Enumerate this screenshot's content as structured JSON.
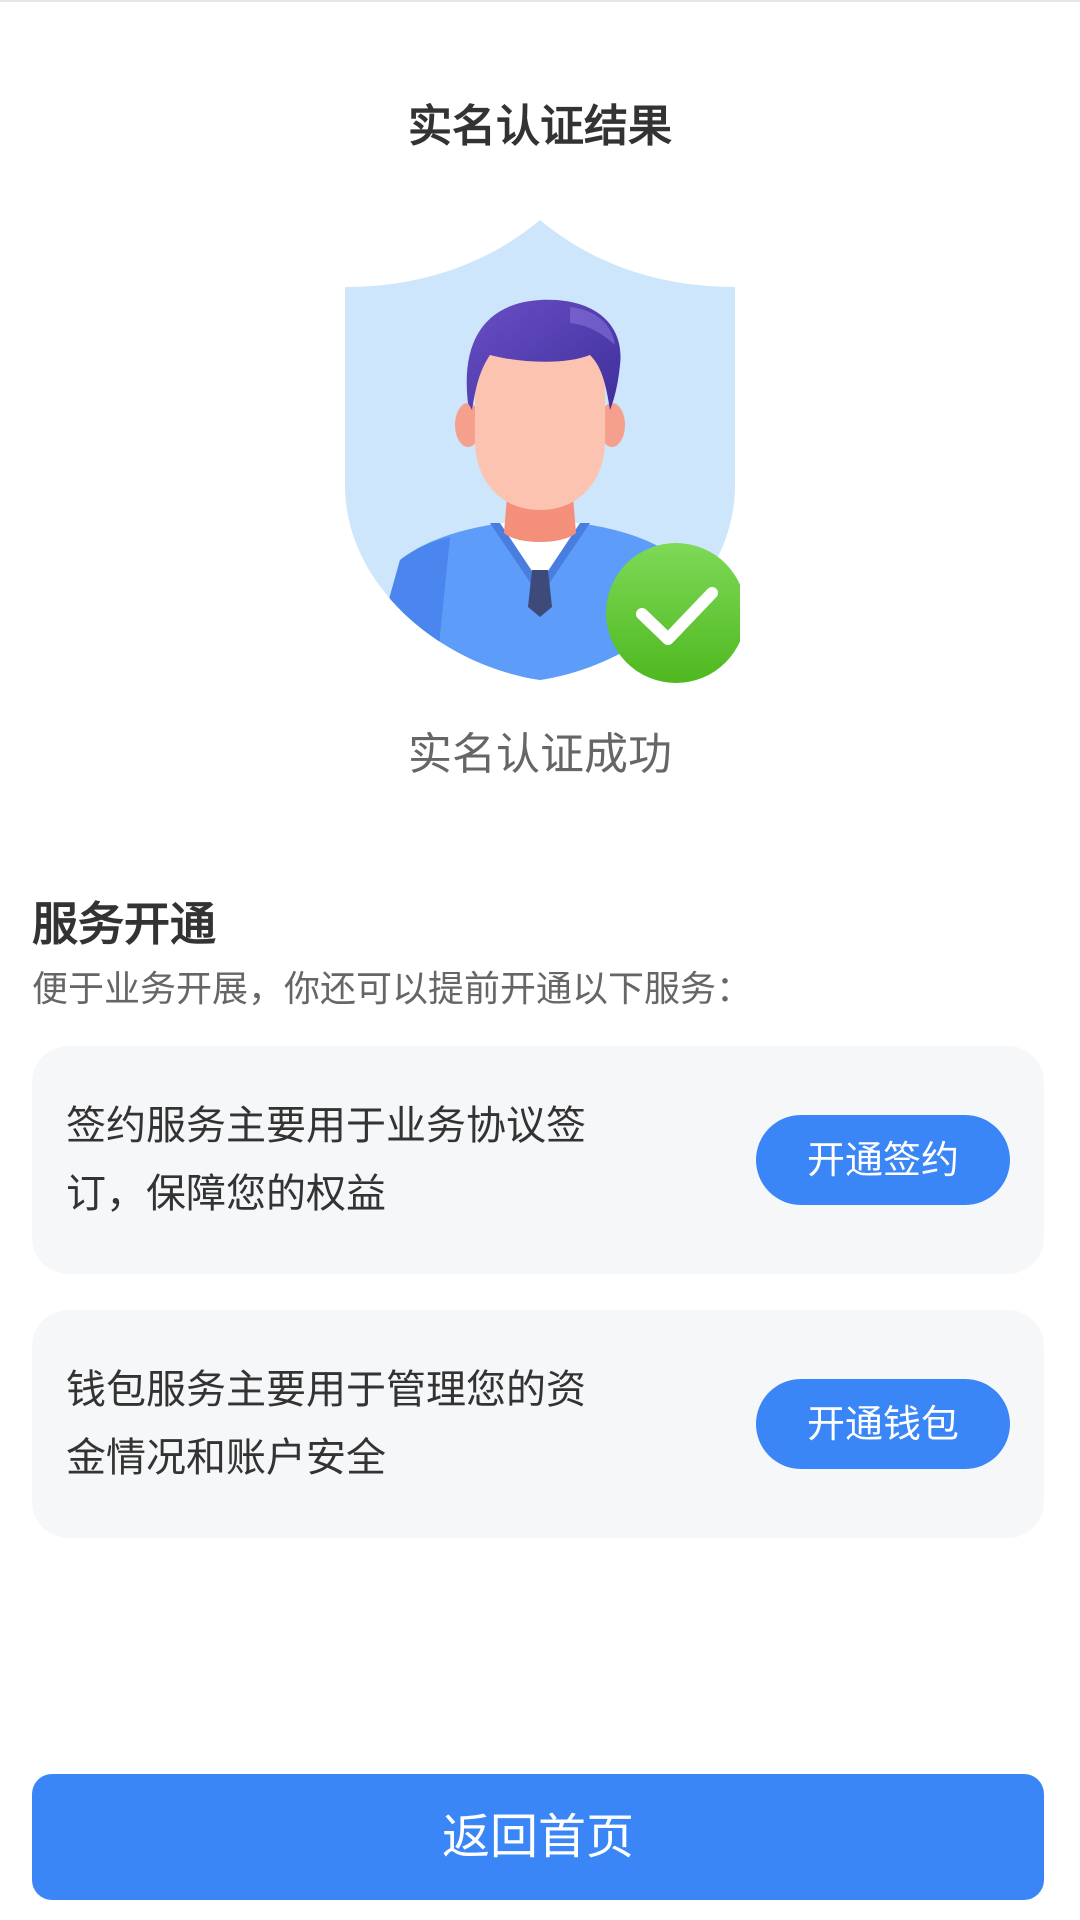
{
  "header": {
    "title": "实名认证结果"
  },
  "result": {
    "status_text": "实名认证成功",
    "illustration_icon": "verified-user-shield-icon",
    "check_icon": "check-icon",
    "colors": {
      "shield": "#cde6fb",
      "sweater": "#5d9cf8",
      "check": "#5cc52a"
    }
  },
  "services": {
    "title": "服务开通",
    "subtitle": "便于业务开展，你还可以提前开通以下服务：",
    "items": [
      {
        "description": "签约服务主要用于业务协议签订，保障您的权益",
        "button_label": "开通签约"
      },
      {
        "description": "钱包服务主要用于管理您的资金情况和账户安全",
        "button_label": "开通钱包"
      }
    ]
  },
  "footer": {
    "home_button_label": "返回首页"
  },
  "colors": {
    "accent": "#3a86f7",
    "card_background": "#f6f7f9"
  }
}
